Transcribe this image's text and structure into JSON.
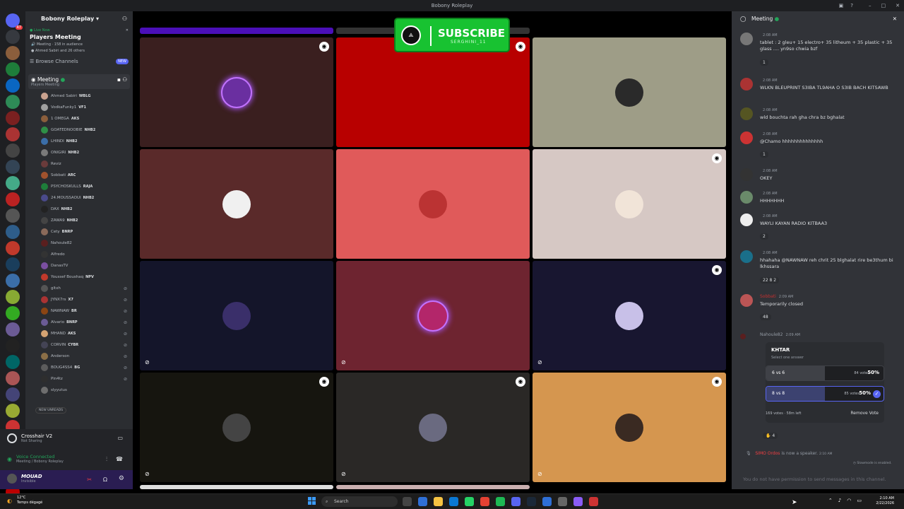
{
  "window": {
    "title": "Bobony Roleplay"
  },
  "server": {
    "name": "Bobony Roleplay",
    "live_label": "Live Now",
    "event_title": "Players Meeting",
    "event_channel": "Meeting",
    "audience": "158 in audience",
    "attendees": "Ahmed Sabiri and 26 others",
    "browse": "Browse Channels",
    "new_tag": "NEW"
  },
  "server_badges": [
    "47",
    "",
    "",
    "",
    "",
    "",
    "",
    "",
    "",
    "",
    "",
    "",
    "",
    "",
    "",
    "",
    "",
    "",
    "",
    "",
    "",
    "",
    "",
    "",
    "",
    "",
    "",
    "",
    "",
    "NEW"
  ],
  "voice_channel": {
    "name": "Meeting",
    "sub": "Players Meeting"
  },
  "members": [
    {
      "name": "Ahmed Sabiri",
      "tag": "WBLG",
      "color": "#c9a28f"
    },
    {
      "name": "VodkaFunky1",
      "tag": "VF1",
      "color": "#a0a0a0"
    },
    {
      "name": "1 OMEGA",
      "tag": "AKS",
      "color": "#8b5e3c"
    },
    {
      "name": "GOATEDNOOBIE",
      "tag": "NHB2",
      "color": "#2f8f46"
    },
    {
      "name": "LHINDI",
      "tag": "NHB2",
      "color": "#3b6ea8"
    },
    {
      "name": "ONIGIRI",
      "tag": "NHB2",
      "color": "#7a7a7a"
    },
    {
      "name": "Reviz",
      "tag": "",
      "color": "#6a3b3b"
    },
    {
      "name": "Sobbati",
      "tag": "ARC",
      "color": "#a0522d"
    },
    {
      "name": "PSYCHOSKULLS",
      "tag": "RAJA",
      "color": "#1e7d3a"
    },
    {
      "name": "24.MOUSSAOUI",
      "tag": "NHB2",
      "color": "#4a4a8a"
    },
    {
      "name": "DAX",
      "tag": "NHB2",
      "color": "#222"
    },
    {
      "name": "ZAWA9",
      "tag": "NHB2",
      "color": "#444"
    },
    {
      "name": "Cety",
      "tag": "BNRP",
      "color": "#8a6a5a"
    },
    {
      "name": "Nahoule82",
      "tag": "",
      "color": "#5a1f1f"
    },
    {
      "name": "Alfredo",
      "tag": "",
      "color": "#333"
    },
    {
      "name": "DanasTV",
      "tag": "",
      "color": "#7a4fa0"
    },
    {
      "name": "Youssef Boushaq",
      "tag": "NPV",
      "color": "#c0392b"
    },
    {
      "name": "gltxh",
      "tag": "",
      "color": "#555"
    },
    {
      "name": "JYNX7rs",
      "tag": "X7",
      "color": "#a33"
    },
    {
      "name": "NAWNAW",
      "tag": "BR",
      "color": "#8b4513"
    },
    {
      "name": "Alvario",
      "tag": "BNRP",
      "color": "#6b5b95"
    },
    {
      "name": "MHAND",
      "tag": "AKS",
      "color": "#d4a373"
    },
    {
      "name": "CORVIN",
      "tag": "CYBR",
      "color": "#445"
    },
    {
      "name": "Anderson",
      "tag": "",
      "color": "#8b6f47"
    },
    {
      "name": "BOUG4SS4",
      "tag": "BG",
      "color": "#5c5c5c"
    },
    {
      "name": "Pin4tz",
      "tag": "",
      "color": "#2e2e2e"
    },
    {
      "name": "slyyutus",
      "tag": "",
      "color": "#6e6e6e"
    }
  ],
  "new_unreads": "NEW UNREADS",
  "user_panel": {
    "stream_name": "Crosshair V2",
    "stream_sub": "Not Sharing",
    "voice_status": "Voice Connected",
    "voice_path": "Meeting / Bobony Roleplay",
    "username": "MOUAD",
    "status": "Invisible"
  },
  "promo": {
    "title": "SUBSCRIBE",
    "sub": "SERGHINI_11"
  },
  "chat": {
    "title": "Meeting",
    "messages": [
      {
        "text": "tablet : 2 gleu+ 15 electro+ 35 litheum + 35 plastic + 35 glass .... yn9so chwia bzf",
        "time": "2:08 AM",
        "reaction": "1"
      },
      {
        "text": "WLKN BLEUPRINT S3IBA TL9AHA O S3IB BACH KITSAWB",
        "time": "2:08 AM",
        "reaction": ""
      },
      {
        "text": "wld bouchta rah gha chra bz bghalat",
        "time": "2:08 AM",
        "reaction": ""
      },
      {
        "text": "@Chamo hhhhhhhhhhhhhh",
        "time": "2:08 AM",
        "reaction": "1"
      },
      {
        "text": "OKEY",
        "time": "2:08 AM",
        "reaction": ""
      },
      {
        "text": "HHHHHHH",
        "time": "2:08 AM",
        "reaction": ""
      },
      {
        "text": "WAYLI KAYAN RADIO KITBAA3",
        "time": "2:08 AM",
        "reaction": "2"
      },
      {
        "text": "hhahaha @NAWNAW reh chrit 25 blghalat rire be3thum bi lkhssara",
        "time": "2:08 AM",
        "reaction": "22   8   2"
      },
      {
        "text": "Temporarily closed",
        "time": "2:09 AM",
        "reaction": "48"
      }
    ],
    "names": [
      "Sobbati",
      "Nahoule82"
    ],
    "poll_time": "2:09 AM",
    "poll": {
      "question": "KHTAR",
      "hint": "Select one answer",
      "options": [
        {
          "label": "6 vs 6",
          "votes": "84 votes",
          "pct": "50%",
          "share": 0.5
        },
        {
          "label": "8 vs 8",
          "votes": "85 votes",
          "pct": "50%",
          "share": 0.5
        }
      ],
      "footer": "169 votes · 58m left",
      "remove": "Remove Vote"
    },
    "poll_reaction": "4",
    "speaker_name": "SIMO Ordos",
    "speaker_text": "is now a speaker.",
    "speaker_time": "2:10 AM",
    "slowmode": "Slowmode is enabled.",
    "input_placeholder": "You do not have permission to send messages in this channel."
  },
  "taskbar": {
    "temp": "12°C",
    "weather": "Temps dégagé",
    "search": "Search",
    "time": "2:10 AM",
    "date": "2/22/2026"
  }
}
